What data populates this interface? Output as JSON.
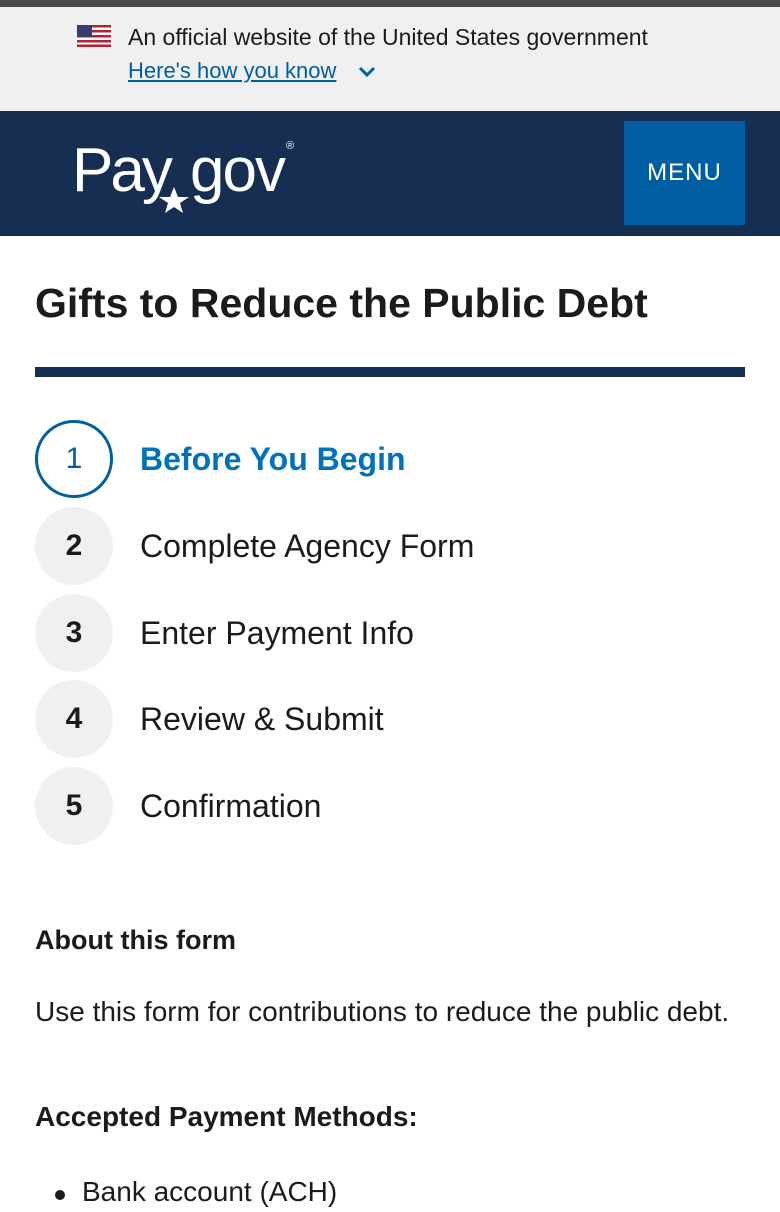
{
  "gov_banner": {
    "text": "An official website of the United States government",
    "link_label": "Here's how you know"
  },
  "header": {
    "logo_text": "Pay.gov",
    "menu_label": "MENU"
  },
  "page": {
    "title": "Gifts to Reduce the Public Debt"
  },
  "steps": [
    {
      "number": "1",
      "label": "Before You Begin",
      "status": "current"
    },
    {
      "number": "2",
      "label": "Complete Agency Form",
      "status": "upcoming"
    },
    {
      "number": "3",
      "label": "Enter Payment Info",
      "status": "upcoming"
    },
    {
      "number": "4",
      "label": "Review & Submit",
      "status": "upcoming"
    },
    {
      "number": "5",
      "label": "Confirmation",
      "status": "upcoming"
    }
  ],
  "about": {
    "heading": "About this form",
    "text": "Use this form for contributions to reduce the public debt."
  },
  "payment_methods": {
    "heading": "Accepted Payment Methods:",
    "items": [
      "Bank account (ACH)"
    ]
  },
  "icons": {
    "flag": "us-flag-icon",
    "chevron": "chevron-down-icon",
    "star": "star-icon"
  },
  "colors": {
    "banner_bg": "#f0f0f0",
    "header_bg": "#162e51",
    "primary": "#005ea2",
    "current_step": "#0071bb",
    "step_bg": "#f0f0f0"
  }
}
